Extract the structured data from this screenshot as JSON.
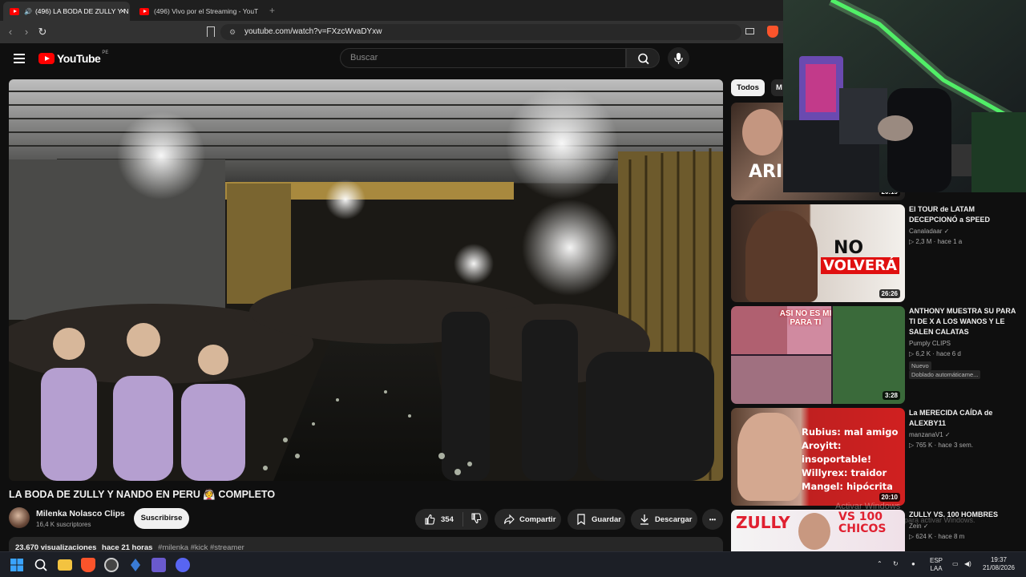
{
  "browser": {
    "tabs": [
      {
        "label": "(496) LA BODA DE ZULLY Y N",
        "active": true
      },
      {
        "label": "(496) Vivo por el Streaming - YouTub",
        "active": false
      }
    ],
    "new_tab": "+",
    "tab_close": "×",
    "url": "youtube.com/watch?v=FXzcWvaDYxw"
  },
  "header": {
    "logo": "YouTube",
    "country": "PE",
    "search_placeholder": "Buscar"
  },
  "video": {
    "title": "LA BODA DE ZULLY Y NANDO EN PERU 👰 COMPLETO",
    "channel": "Milenka Nolasco Clips",
    "subscribers": "16,4 K suscriptores",
    "subscribe_label": "Suscribirse",
    "likes": "354",
    "share_label": "Compartir",
    "save_label": "Guardar",
    "download_label": "Descargar",
    "more_label": "•••",
    "views": "23.670 visualizaciones",
    "age": "hace 21 horas",
    "tags": "#milenka #kick #streamer"
  },
  "sidebar": {
    "chips": [
      "Todos",
      "M"
    ],
    "items": [
      {
        "title": "",
        "channel": "",
        "meta": "",
        "duration": "20:19",
        "badge": ""
      },
      {
        "title": "El TOUR de LATAM DECEPCIONÓ a SPEED",
        "channel": "Canaladaar ✓",
        "meta": "▷ 2,3 M · hace 1 a",
        "duration": "26:26",
        "badge": ""
      },
      {
        "title": "ANTHONY MUESTRA SU PARA TI DE X A LOS WANOS Y LE SALEN CALATAS",
        "channel": "Pumply CLIPS",
        "meta": "▷ 6,2 K · hace 6 d",
        "duration": "3:28",
        "badge": "Nuevo",
        "badge2": "Doblado automáticame..."
      },
      {
        "title": "La MERECIDA CAÍDA de ALEXBY11",
        "channel": "manzanaV1 ✓",
        "meta": "▷ 765 K · hace 3 sem.",
        "duration": "20:10",
        "badge": ""
      },
      {
        "title": "ZULLY VS. 100 HOMBRES",
        "channel": "Zein ✓",
        "meta": "▷ 624 K · hace 8 m",
        "duration": "",
        "badge": ""
      }
    ],
    "thumb_texts": {
      "t1": "ARI",
      "t2a": "NO",
      "t2b": "VOLVERÁ",
      "t3": "ASI NO ES MI PARA TI",
      "t4": [
        "Rubius: mal amigo",
        "Aroyitt: insoportable!",
        "Willyrex: traidor",
        "Mangel: hipócrita"
      ],
      "t5a": "ZULLY",
      "t5b": "VS 100 CHICOS"
    }
  },
  "watermark": {
    "line1": "Activar Windows",
    "line2": "para activar Windows."
  },
  "taskbar": {
    "lang": "ESP",
    "lang2": "LAA",
    "time": "19:37",
    "date": "21/08/2026"
  },
  "colors": {
    "brand": "#ff0000",
    "background": "#0f0f0f",
    "chip": "#272727"
  }
}
